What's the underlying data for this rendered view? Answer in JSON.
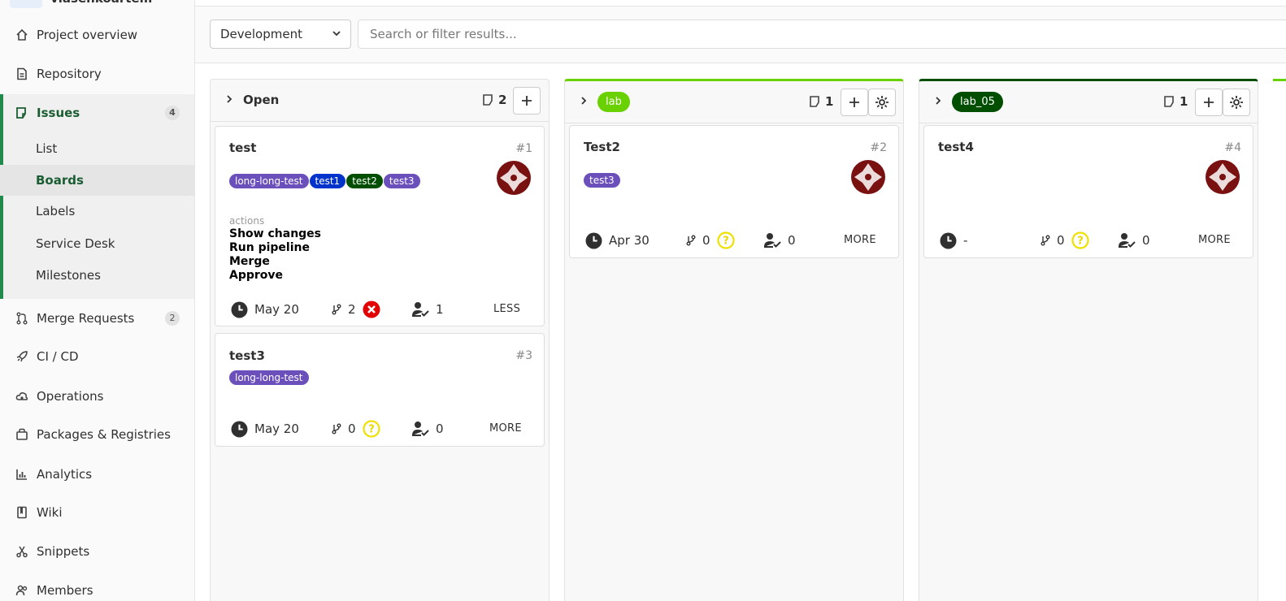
{
  "project": {
    "name": "vlasenkoartem"
  },
  "sidebar": {
    "items": [
      {
        "label": "Project overview",
        "icon": "home-icon"
      },
      {
        "label": "Repository",
        "icon": "document-icon"
      },
      {
        "label": "Issues",
        "icon": "issues-icon",
        "badge": "4"
      },
      {
        "label": "Merge Requests",
        "icon": "merge-request-icon",
        "badge": "2"
      },
      {
        "label": "CI / CD",
        "icon": "rocket-icon"
      },
      {
        "label": "Operations",
        "icon": "cloud-gear-icon"
      },
      {
        "label": "Packages & Registries",
        "icon": "package-icon"
      },
      {
        "label": "Analytics",
        "icon": "chart-icon"
      },
      {
        "label": "Wiki",
        "icon": "book-icon"
      },
      {
        "label": "Snippets",
        "icon": "scissors-icon"
      },
      {
        "label": "Members",
        "icon": "users-icon"
      }
    ],
    "issues_sub": [
      "List",
      "Boards",
      "Labels",
      "Service Desk",
      "Milestones"
    ],
    "active_sub": "Boards"
  },
  "filter": {
    "scope": "Development",
    "search_placeholder": "Search or filter results..."
  },
  "lists": [
    {
      "title": "Open",
      "count": "2",
      "cards": [
        {
          "title": "test",
          "number": "#1",
          "labels": [
            {
              "text": "long-long-test",
              "color": "#6b4fbb"
            },
            {
              "text": "test1",
              "color": "#0033cc"
            },
            {
              "text": "test2",
              "color": "#004e00"
            },
            {
              "text": "test3",
              "color": "#6b4fbb"
            }
          ],
          "actions_label": "actions",
          "actions": [
            "Show changes",
            "Run pipeline",
            "Merge",
            "Approve"
          ],
          "due": "May 20",
          "mrs": "2",
          "mr_status": "failed",
          "approvals": "1",
          "toggle": "LESS"
        },
        {
          "title": "test3",
          "number": "#3",
          "labels": [
            {
              "text": "long-long-test",
              "color": "#6b4fbb"
            }
          ],
          "due": "May 20",
          "mrs": "0",
          "mr_status": "unknown",
          "approvals": "0",
          "toggle": "MORE"
        }
      ]
    },
    {
      "label": {
        "text": "lab",
        "color": "#69d100"
      },
      "count": "1",
      "cards": [
        {
          "title": "Test2",
          "number": "#2",
          "labels": [
            {
              "text": "test3",
              "color": "#6b4fbb"
            }
          ],
          "due": "Apr 30",
          "mrs": "0",
          "mr_status": "unknown",
          "approvals": "0",
          "toggle": "MORE"
        }
      ]
    },
    {
      "label": {
        "text": "lab_05",
        "color": "#004e00"
      },
      "count": "1",
      "cards": [
        {
          "title": "test4",
          "number": "#4",
          "labels": [],
          "due": "-",
          "mrs": "0",
          "mr_status": "unknown",
          "approvals": "0",
          "toggle": "MORE"
        }
      ]
    }
  ]
}
